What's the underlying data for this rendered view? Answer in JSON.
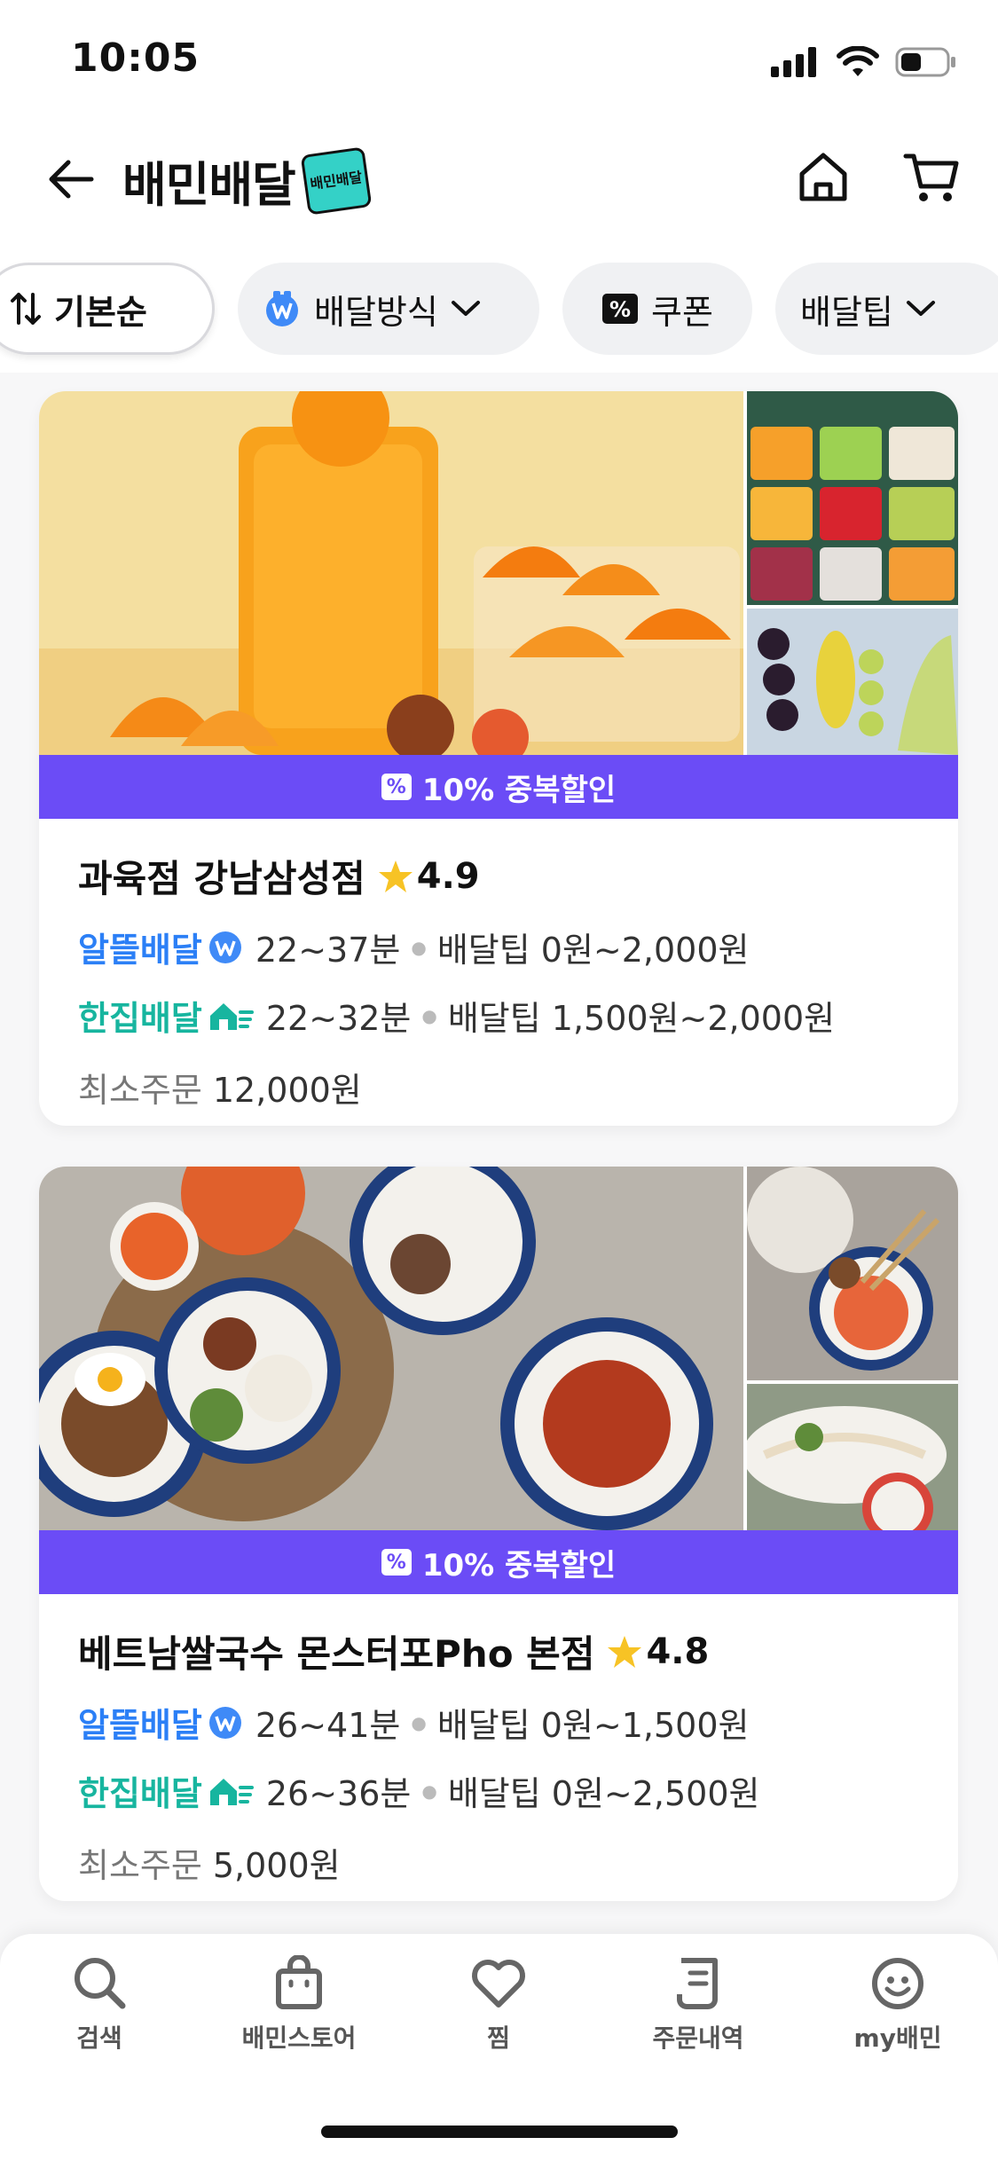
{
  "status_bar": {
    "time": "10:05"
  },
  "header": {
    "title": "배민배달",
    "badge_text": "배민배달"
  },
  "filters": [
    {
      "label": "기본순"
    },
    {
      "label": "배달방식"
    },
    {
      "label": "쿠폰"
    },
    {
      "label": "배달팁"
    }
  ],
  "stores": [
    {
      "promo": "10% 중복할인",
      "name": "과육점 강남삼성점",
      "rating": "4.9",
      "save_delivery": {
        "label": "알뜰배달",
        "time": "22~37분",
        "tip": "배달팁 0원~2,000원"
      },
      "single_delivery": {
        "label": "한집배달",
        "time": "22~32분",
        "tip": "배달팁 1,500원~2,000원"
      },
      "min_order_label": "최소주문",
      "min_order_value": "12,000원"
    },
    {
      "promo": "10% 중복할인",
      "name": "베트남쌀국수 몬스터포Pho 본점",
      "rating": "4.8",
      "save_delivery": {
        "label": "알뜰배달",
        "time": "26~41분",
        "tip": "배달팁 0원~1,500원"
      },
      "single_delivery": {
        "label": "한집배달",
        "time": "26~36분",
        "tip": "배달팁 0원~2,500원"
      },
      "min_order_label": "최소주문",
      "min_order_value": "5,000원"
    }
  ],
  "tabbar": [
    {
      "label": "검색",
      "icon": "search-icon"
    },
    {
      "label": "배민스토어",
      "icon": "shopping-bag-icon"
    },
    {
      "label": "찜",
      "icon": "heart-icon"
    },
    {
      "label": "주문내역",
      "icon": "receipt-icon"
    },
    {
      "label": "my배민",
      "icon": "smile-face-icon"
    }
  ],
  "colors": {
    "promo": "#6b4cf6",
    "save_delivery": "#2b7ff6",
    "single_delivery": "#17b59f",
    "star": "#f7c325"
  }
}
